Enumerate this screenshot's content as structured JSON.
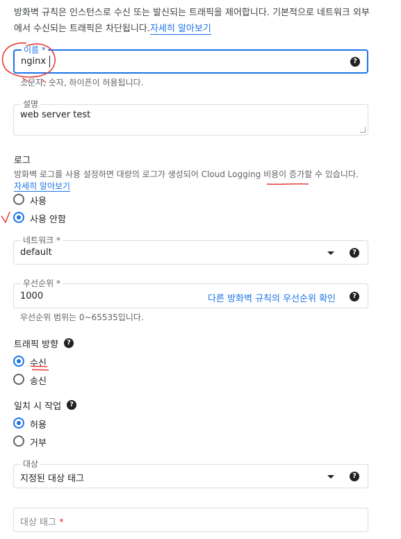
{
  "intro": {
    "text": "방화벽 규칙은 인스턴스로 수신 또는 발신되는 트래픽을 제어합니다. 기본적으로 네트워크 외부에서 수신되는 트래픽은 차단됩니다.",
    "link": "자세히 알아보기"
  },
  "name_field": {
    "label": "이름 *",
    "value": "nginx",
    "hint": "소문자, 숫자, 하이픈이 허용됩니다.",
    "help": "?"
  },
  "description_field": {
    "label": "설명",
    "value": "web server test"
  },
  "logs": {
    "title": "로그",
    "desc": "방화벽 로그를 사용 설정하면 대량의 로그가 생성되어 Cloud Logging 비용이 증가할 수 있습니다.",
    "link": "자세히 알아보기",
    "options": [
      "사용",
      "사용 안함"
    ],
    "selected": "사용 안함"
  },
  "network_field": {
    "label": "네트워크 *",
    "value": "default",
    "help": "?"
  },
  "priority_field": {
    "label": "우선순위 *",
    "value": "1000",
    "link": "다른 방화벽 규칙의 우선순위 확인",
    "hint": "우선순위 범위는 0~65535입니다.",
    "help": "?"
  },
  "direction": {
    "title": "트래픽 방향",
    "options": [
      "수신",
      "송신"
    ],
    "selected": "수신",
    "help": "?"
  },
  "action": {
    "title": "일치 시 작업",
    "options": [
      "허용",
      "거부"
    ],
    "selected": "허용",
    "help": "?"
  },
  "target_field": {
    "label": "대상",
    "value": "지정된 대상 태그",
    "help": "?"
  },
  "target_tags_field": {
    "placeholder": "대상 태그",
    "required_mark": "*"
  },
  "colors": {
    "accent": "#1a73e8",
    "annotation": "#e53935",
    "text": "#202124",
    "muted": "#5f6368"
  }
}
